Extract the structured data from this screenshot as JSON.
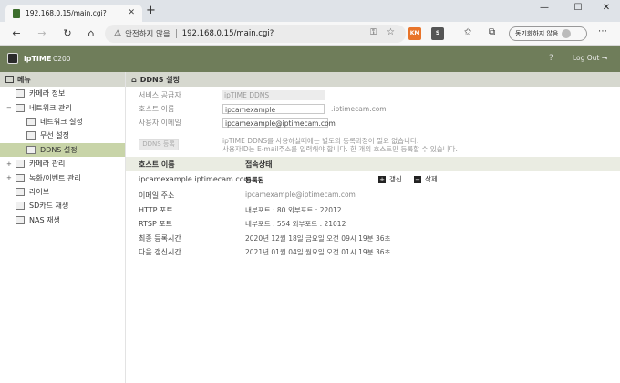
{
  "browser": {
    "tab_title": "192.168.0.15/main.cgi?",
    "tab_close": "✕",
    "new_tab": "+",
    "win_min": "—",
    "win_max": "☐",
    "win_close": "✕",
    "security_text": "안전하지 않음",
    "url": "192.168.0.15/main.cgi?",
    "ext1": "KM",
    "ext2": "S",
    "sync_label": "동기화하지 않음"
  },
  "header": {
    "logo": "ipTIME",
    "model": "C200",
    "help": "?",
    "logout": "Log Out"
  },
  "sidebar": {
    "title": "메뉴",
    "items": [
      {
        "label": "카메라 정보"
      },
      {
        "label": "네트워크 관리",
        "expander": "−"
      },
      {
        "label": "네트워크 설정"
      },
      {
        "label": "무선 설정"
      },
      {
        "label": "DDNS 설정"
      },
      {
        "label": "카메라 관리",
        "expander": "+"
      },
      {
        "label": "녹화/이벤트 관리",
        "expander": "+"
      },
      {
        "label": "라이브"
      },
      {
        "label": "SD카드 재생"
      },
      {
        "label": "NAS 재생"
      }
    ]
  },
  "main": {
    "title": "DDNS 설정",
    "service_label": "서비스 공급자",
    "service_value": "ipTIME DDNS",
    "host_label": "호스트 이름",
    "host_value": "ipcamexample",
    "host_suffix": ".iptimecam.com",
    "email_label": "사용자 이메일",
    "email_value": "ipcamexample@iptimecam.com",
    "register_button": "DDNS 등록",
    "notice_1": "ipTIME DDNS를 사용하실때에는 별도의 등록과정이 필요 없습니다.",
    "notice_2": "사용자ID는 E-mail주소를 입력해야 합니다. 한 개의 호스트만 등록할 수 있습니다.",
    "col_host": "호스트 이름",
    "col_status": "접속상태",
    "row_host": "ipcamexample.iptimecam.com",
    "row_status": "등록됨",
    "refresh_label": "갱신",
    "delete_label": "삭제",
    "details": [
      {
        "label": "이메일 주소",
        "value": "ipcamexample@iptimecam.com"
      },
      {
        "label": "HTTP 포트",
        "value": "내부포트 : 80   외부포트 : 22012"
      },
      {
        "label": "RTSP 포트",
        "value": "내부포트 : 554   외부포트 : 21012"
      },
      {
        "label": "최종 등록시간",
        "value": "2020년 12월 18일 금요일 오전 09시 19분 36초"
      },
      {
        "label": "다음 갱신시간",
        "value": "2021년 01월 04일 월요일 오전 01시 19분 36초"
      }
    ]
  },
  "colors": {
    "header_bg": "#6f7d5a",
    "selected_bg": "#c8d4a8",
    "bar_bg": "#d6d8cf"
  }
}
